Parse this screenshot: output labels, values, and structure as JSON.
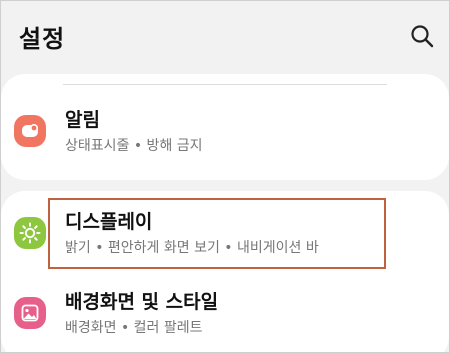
{
  "header": {
    "title": "설정",
    "search_icon": "search-icon"
  },
  "colors": {
    "highlight_border": "#c0613f",
    "alarm_icon_bg": "#f07662",
    "display_icon_bg": "#8dc63f",
    "wallpaper_icon_bg": "#e6608a"
  },
  "items": [
    {
      "label": "알림",
      "subtitle": "상태표시줄 • 방해 금지",
      "icon": "notification-icon"
    },
    {
      "label": "디스플레이",
      "subtitle": "밝기 • 편안하게 화면 보기 • 내비게이션 바",
      "icon": "sun-icon"
    },
    {
      "label": "배경화면 및 스타일",
      "subtitle": "배경화면 • 컬러 팔레트",
      "icon": "image-icon"
    }
  ]
}
